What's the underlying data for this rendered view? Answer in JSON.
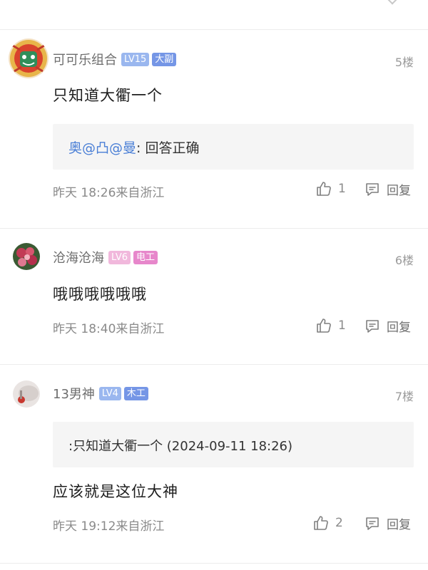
{
  "posts": [
    {
      "username": "可可乐组合",
      "level": "LV15",
      "level_color": "#9ab7ef",
      "title_badge": "大副",
      "title_color": "#7596e6",
      "floor": "5楼",
      "content": "只知道大衢一个",
      "quote": {
        "mentions": "奥@凸@曼",
        "colon": ": ",
        "text": "回答正确"
      },
      "meta": "昨天 18:26来自浙江",
      "likes": "1",
      "reply_label": "回复"
    },
    {
      "username": "沧海沧海",
      "level": "LV6",
      "level_color": "#f1b8dc",
      "title_badge": "电工",
      "title_color": "#e787cb",
      "floor": "6楼",
      "content": "哦哦哦哦哦哦",
      "meta": "昨天 18:40来自浙江",
      "likes": "1",
      "reply_label": "回复"
    },
    {
      "username": "13男神",
      "level": "LV4",
      "level_color": "#9ab7ef",
      "title_badge": "木工",
      "title_color": "#7596e6",
      "floor": "7楼",
      "quoted_reply": ":只知道大衢一个 (2024-09-11 18:26)",
      "content": "应该就是这位大神",
      "meta": "昨天 19:12来自浙江",
      "likes": "2",
      "reply_label": "回复"
    }
  ]
}
